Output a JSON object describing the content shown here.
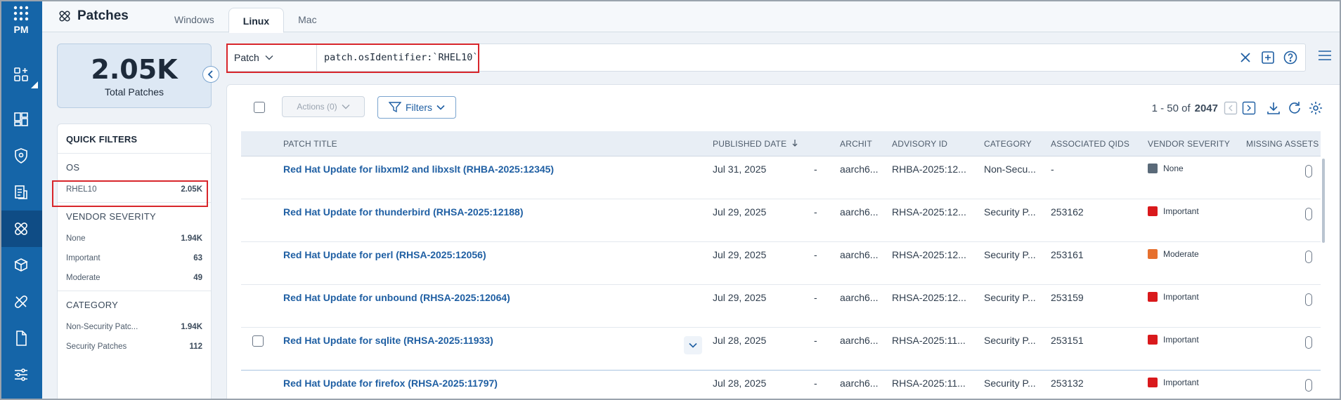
{
  "rail": {
    "top_label": "PM",
    "items": [
      {
        "name": "dashboard-add-icon"
      },
      {
        "name": "widgets-icon"
      },
      {
        "name": "shield-gear-icon"
      },
      {
        "name": "report-icon"
      },
      {
        "name": "patches-icon",
        "active": true
      },
      {
        "name": "package-icon"
      },
      {
        "name": "tools-icon"
      },
      {
        "name": "document-icon"
      },
      {
        "name": "sliders-icon"
      }
    ]
  },
  "header": {
    "title": "Patches",
    "tabs": [
      "Windows",
      "Linux",
      "Mac"
    ],
    "active_tab": "Linux"
  },
  "summary": {
    "count": "2.05K",
    "label": "Total Patches"
  },
  "quick_filters": {
    "title": "QUICK FILTERS",
    "sections": [
      {
        "title": "OS",
        "items": [
          {
            "label": "RHEL10",
            "count": "2.05K"
          }
        ]
      },
      {
        "title": "VENDOR SEVERITY",
        "items": [
          {
            "label": "None",
            "count": "1.94K"
          },
          {
            "label": "Important",
            "count": "63"
          },
          {
            "label": "Moderate",
            "count": "49"
          }
        ]
      },
      {
        "title": "CATEGORY",
        "items": [
          {
            "label": "Non-Security Patc...",
            "count": "1.94K"
          },
          {
            "label": "Security Patches",
            "count": "112"
          }
        ]
      }
    ]
  },
  "search": {
    "type": "Patch",
    "query": "patch.osIdentifier:`RHEL10`"
  },
  "toolbar": {
    "actions_label": "Actions (0)",
    "filters_label": "Filters",
    "range": "1 - 50 of",
    "total": "2047"
  },
  "table": {
    "columns": [
      "PATCH TITLE",
      "PUBLISHED DATE",
      "ARCHIT",
      "ADVISORY ID",
      "CATEGORY",
      "ASSOCIATED QIDS",
      "VENDOR SEVERITY",
      "MISSING ASSETS"
    ],
    "rows": [
      {
        "title": "Red Hat Update for libxml2 and libxslt (RHBA-2025:12345)",
        "date": "Jul 31, 2025",
        "dash": "-",
        "arch": "aarch6...",
        "advisory": "RHBA-2025:12...",
        "category": "Non-Secu...",
        "qids": "-",
        "severity": "None"
      },
      {
        "title": "Red Hat Update for thunderbird (RHSA-2025:12188)",
        "date": "Jul 29, 2025",
        "dash": "-",
        "arch": "aarch6...",
        "advisory": "RHSA-2025:12...",
        "category": "Security P...",
        "qids": "253162",
        "severity": "Important"
      },
      {
        "title": "Red Hat Update for perl (RHSA-2025:12056)",
        "date": "Jul 29, 2025",
        "dash": "-",
        "arch": "aarch6...",
        "advisory": "RHSA-2025:12...",
        "category": "Security P...",
        "qids": "253161",
        "severity": "Moderate"
      },
      {
        "title": "Red Hat Update for unbound (RHSA-2025:12064)",
        "date": "Jul 29, 2025",
        "dash": "-",
        "arch": "aarch6...",
        "advisory": "RHSA-2025:12...",
        "category": "Security P...",
        "qids": "253159",
        "severity": "Important"
      },
      {
        "title": "Red Hat Update for sqlite (RHSA-2025:11933)",
        "date": "Jul 28, 2025",
        "dash": "-",
        "arch": "aarch6...",
        "advisory": "RHSA-2025:11...",
        "category": "Security P...",
        "qids": "253151",
        "severity": "Important"
      },
      {
        "title": "Red Hat Update for firefox (RHSA-2025:11797)",
        "date": "Jul 28, 2025",
        "dash": "-",
        "arch": "aarch6...",
        "advisory": "RHSA-2025:11...",
        "category": "Security P...",
        "qids": "253132",
        "severity": "Important"
      }
    ]
  },
  "colors": {
    "rail": "#1565a8",
    "link": "#1f5fa3",
    "severity_none": "#5a6a79",
    "severity_important": "#d9191c",
    "severity_moderate": "#e6702e",
    "highlight": "#d8262b"
  }
}
